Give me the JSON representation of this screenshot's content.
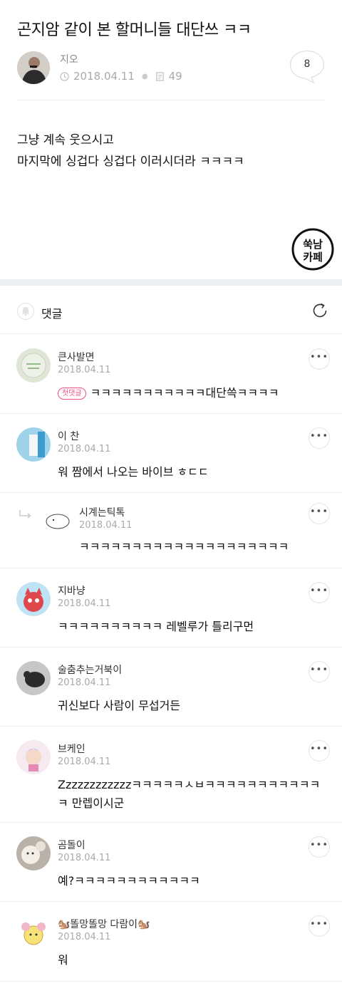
{
  "post": {
    "title": "곤지암 같이 본 할머니들 대단쓰 ㅋㅋ",
    "author": "지오",
    "date": "2018.04.11",
    "views": "49",
    "comment_count": "8",
    "content_lines": [
      "그냥 계속 웃으시고",
      "마지막에 싱겁다 싱겁다 이러시더라 ㅋㅋㅋㅋ"
    ]
  },
  "stamp": {
    "line1": "쑥남",
    "line2": "카페"
  },
  "comments_header": {
    "label": "댓글"
  },
  "comments": [
    {
      "name": "큰사발면",
      "date": "2018.04.11",
      "badge": "첫댓글",
      "text": "ㅋㅋㅋㅋㅋㅋㅋㅋㅋㅋㅋ대단쓱ㅋㅋㅋㅋ"
    },
    {
      "name": "이 찬",
      "date": "2018.04.11",
      "text": "워 짬에서 나오는 바이브 ㅎㄷㄷ"
    },
    {
      "name": "시계는틱톡",
      "date": "2018.04.11",
      "text": "ㅋㅋㅋㅋㅋㅋㅋㅋㅋㅋㅋㅋㅋㅋㅋㅋㅋㅋㅋㅋ"
    },
    {
      "name": "지바냥",
      "date": "2018.04.11",
      "text": "ㅋㅋㅋㅋㅋㅋㅋㅋㅋㅋ 레벨루가 틀리구먼"
    },
    {
      "name": "술춤추는거북이",
      "date": "2018.04.11",
      "text": "귀신보다 사람이 무섭거든"
    },
    {
      "name": "브케인",
      "date": "2018.04.11",
      "text": "Zzzzzzzzzzzzㅋㅋㅋㅋㅋㅅㅂㅋㅋㅋㅋㅋㅋㅋㅋㅋㅋㅋㅋ 만렙이시군"
    },
    {
      "name": "곰돌이",
      "date": "2018.04.11",
      "text": "예?ㅋㅋㅋㅋㅋㅋㅋㅋㅋㅋㅋㅋ"
    },
    {
      "name": "🐿️똘망똘망 다람이🐿️",
      "date": "2018.04.11",
      "text": "워"
    }
  ],
  "icons": {
    "more": "more-dots-icon",
    "refresh": "refresh-icon",
    "bell": "bell-icon",
    "clock": "clock-icon",
    "views": "document-icon",
    "reply": "reply-arrow-icon"
  },
  "colors": {
    "badge": "#ef4d84",
    "meta": "#aaaaaa",
    "separator": "#eceff1"
  }
}
